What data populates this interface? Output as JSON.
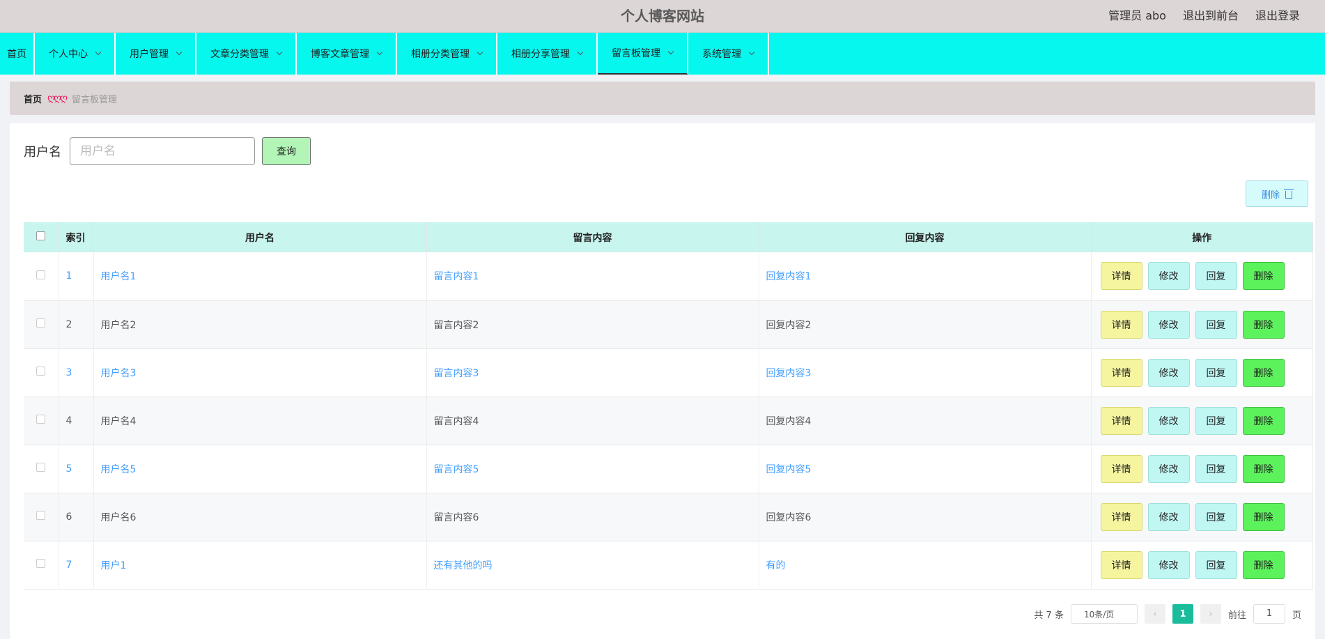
{
  "header": {
    "title": "个人博客网站",
    "admin_label": "管理员 abo",
    "front_label": "退出到前台",
    "logout_label": "退出登录"
  },
  "nav": {
    "items": [
      {
        "label": "首页"
      },
      {
        "label": "个人中心"
      },
      {
        "label": "用户管理"
      },
      {
        "label": "文章分类管理"
      },
      {
        "label": "博客文章管理"
      },
      {
        "label": "相册分类管理"
      },
      {
        "label": "相册分享管理"
      },
      {
        "label": "留言板管理"
      },
      {
        "label": "系统管理"
      }
    ],
    "active": "留言板管理"
  },
  "breadcrumb": {
    "home": "首页",
    "separator": "ღღღ",
    "current": "留言板管理"
  },
  "search": {
    "label": "用户名",
    "placeholder": "用户名",
    "button": "查询"
  },
  "toolbar": {
    "delete_label": "删除"
  },
  "table": {
    "headers": {
      "index": "索引",
      "username": "用户名",
      "message": "留言内容",
      "reply": "回复内容",
      "actions": "操作"
    },
    "rows": [
      {
        "index": "1",
        "username": "用户名1",
        "message": "留言内容1",
        "reply": "回复内容1"
      },
      {
        "index": "2",
        "username": "用户名2",
        "message": "留言内容2",
        "reply": "回复内容2"
      },
      {
        "index": "3",
        "username": "用户名3",
        "message": "留言内容3",
        "reply": "回复内容3"
      },
      {
        "index": "4",
        "username": "用户名4",
        "message": "留言内容4",
        "reply": "回复内容4"
      },
      {
        "index": "5",
        "username": "用户名5",
        "message": "留言内容5",
        "reply": "回复内容5"
      },
      {
        "index": "6",
        "username": "用户名6",
        "message": "留言内容6",
        "reply": "回复内容6"
      },
      {
        "index": "7",
        "username": "用户1",
        "message": "还有其他的吗",
        "reply": "有的"
      }
    ],
    "actions": {
      "detail": "详情",
      "edit": "修改",
      "reply": "回复",
      "delete": "删除"
    }
  },
  "pagination": {
    "total": "共 7 条",
    "page_size": "10条/页",
    "current_page": "1",
    "goto_label": "前往",
    "goto_value": "1",
    "page_suffix": "页"
  },
  "colors": {
    "nav_bg": "#06f7ee",
    "header_bg": "#ddd6d6",
    "link": "#409eff",
    "page_active": "#1abc9c"
  }
}
